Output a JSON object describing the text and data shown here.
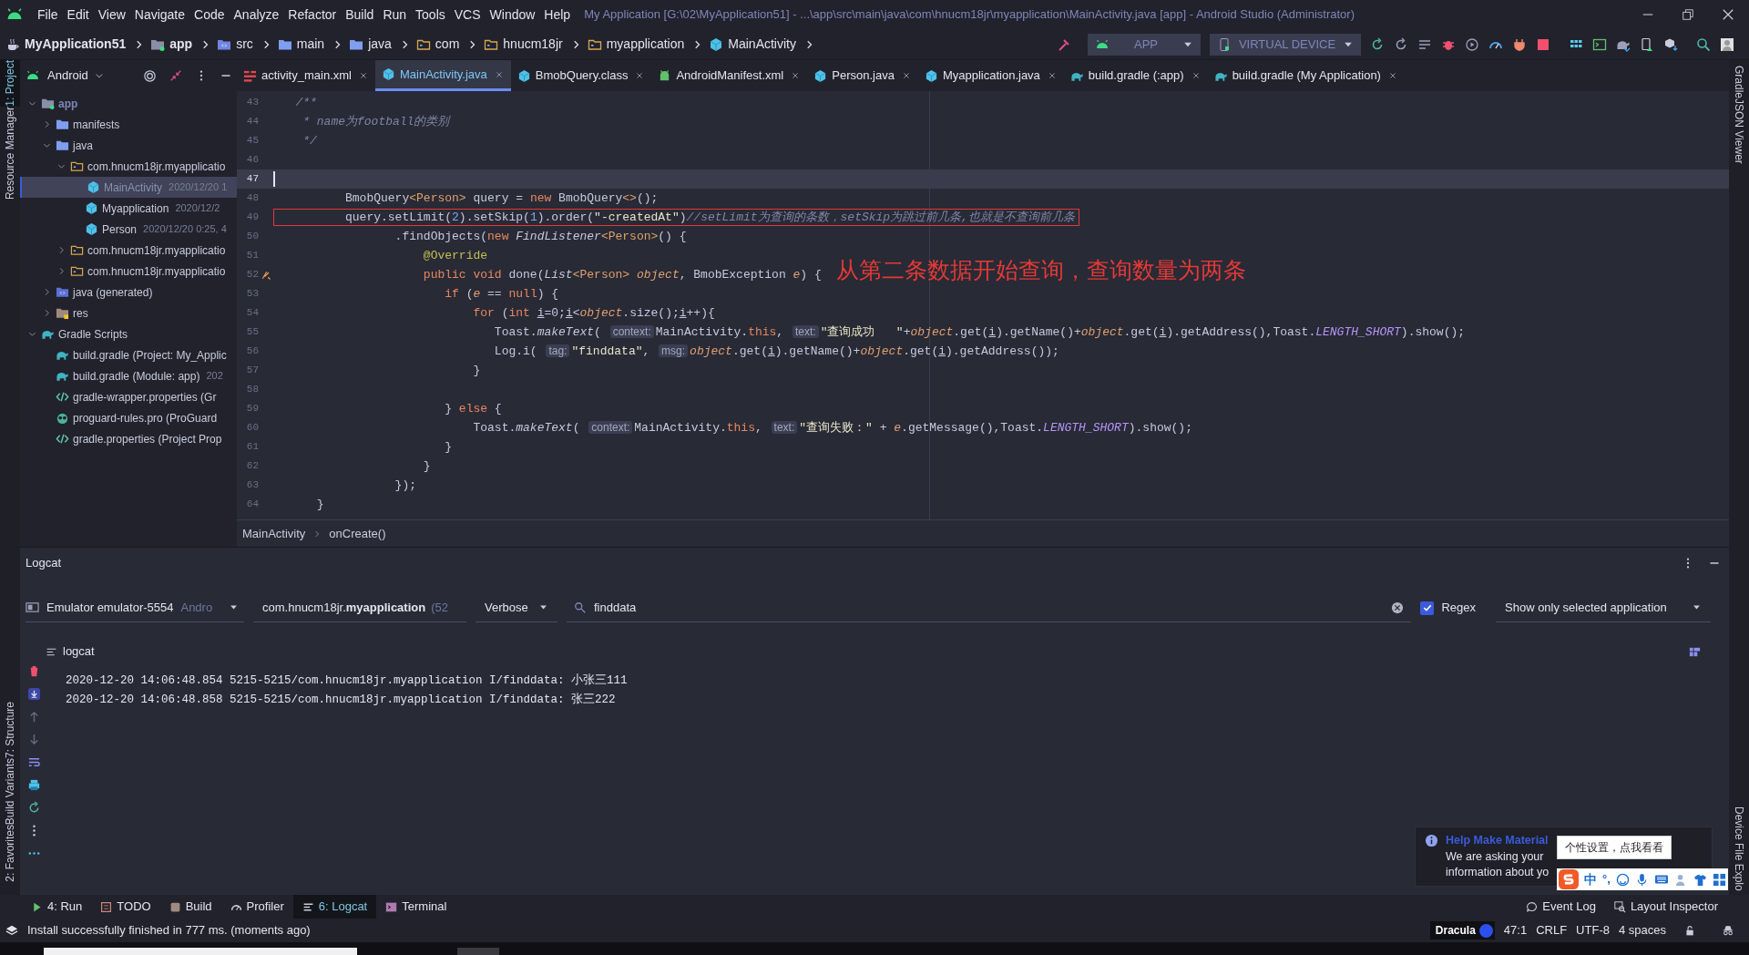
{
  "window": {
    "title": "My Application [G:\\02\\MyApplication51] - ...\\app\\src\\main\\java\\com\\hnucm18jr\\myapplication\\MainActivity.java [app] - Android Studio (Administrator)"
  },
  "menu": [
    "File",
    "Edit",
    "View",
    "Navigate",
    "Code",
    "Analyze",
    "Refactor",
    "Build",
    "Run",
    "Tools",
    "VCS",
    "Window",
    "Help"
  ],
  "breadcrumb": [
    {
      "label": "MyApplication51",
      "kind": "project"
    },
    {
      "label": "app",
      "kind": "module"
    },
    {
      "label": "src",
      "kind": "source"
    },
    {
      "label": "main",
      "kind": "folder"
    },
    {
      "label": "java",
      "kind": "folder"
    },
    {
      "label": "com",
      "kind": "package"
    },
    {
      "label": "hnucm18jr",
      "kind": "package"
    },
    {
      "label": "myapplication",
      "kind": "package"
    },
    {
      "label": "MainActivity",
      "kind": "class"
    }
  ],
  "run_config": {
    "module": "APP",
    "device": "VIRTUAL DEVICE"
  },
  "left_tool_windows": [
    {
      "label": "1: Project",
      "selected": true
    },
    {
      "label": "Resource Manager",
      "selected": false
    }
  ],
  "left_tool_windows_lower": [
    {
      "label": "7: Structure"
    },
    {
      "label": "Build Variants"
    },
    {
      "label": "2: Favorites"
    }
  ],
  "right_tool_windows": [
    "Gradle",
    "JSON Viewer"
  ],
  "right_tool_windows_lower": [
    "Device File Explo"
  ],
  "project_panel": {
    "view": "Android",
    "tree": [
      {
        "label": "app",
        "kind": "module",
        "expanded": true,
        "selected": false,
        "children": [
          {
            "label": "manifests",
            "kind": "folder",
            "expanded": false,
            "selected": false
          },
          {
            "label": "java",
            "kind": "folder",
            "expanded": true,
            "selected": false,
            "children": [
              {
                "label": "com.hnucm18jr.myapplicatio",
                "kind": "package",
                "expanded": true,
                "selected": false,
                "children": [
                  {
                    "label": "MainActivity",
                    "kind": "class",
                    "date": "2020/12/20 1",
                    "selected": true
                  },
                  {
                    "label": "Myapplication",
                    "kind": "class",
                    "date": "2020/12/2",
                    "selected": false
                  },
                  {
                    "label": "Person",
                    "kind": "class",
                    "date": "2020/12/20 0:25, 4",
                    "selected": false
                  }
                ]
              },
              {
                "label": "com.hnucm18jr.myapplicatio",
                "kind": "package",
                "expanded": false,
                "selected": false
              },
              {
                "label": "com.hnucm18jr.myapplicatio",
                "kind": "package",
                "expanded": false,
                "selected": false
              }
            ]
          },
          {
            "label": "java (generated)",
            "kind": "generated",
            "expanded": false,
            "selected": false
          },
          {
            "label": "res",
            "kind": "res",
            "expanded": false,
            "selected": false
          }
        ]
      },
      {
        "label": "Gradle Scripts",
        "kind": "gradle",
        "expanded": true,
        "selected": false,
        "children": [
          {
            "label": "build.gradle (Project: My_Applic",
            "kind": "gradle",
            "selected": false
          },
          {
            "label": "build.gradle (Module: app)",
            "kind": "gradle",
            "date": "202",
            "selected": false
          },
          {
            "label": "gradle-wrapper.properties (Gr",
            "kind": "props",
            "selected": false
          },
          {
            "label": "proguard-rules.pro (ProGuard",
            "kind": "owl",
            "selected": false
          },
          {
            "label": "gradle.properties (Project Prop",
            "kind": "props",
            "selected": false
          }
        ]
      }
    ]
  },
  "editor": {
    "tabs": [
      {
        "label": "activity_main.xml",
        "kind": "layout",
        "selected": false
      },
      {
        "label": "MainActivity.java",
        "kind": "class",
        "selected": true
      },
      {
        "label": "BmobQuery.class",
        "kind": "class",
        "selected": false
      },
      {
        "label": "AndroidManifest.xml",
        "kind": "manifest",
        "selected": false
      },
      {
        "label": "Person.java",
        "kind": "class",
        "selected": false
      },
      {
        "label": "Myapplication.java",
        "kind": "class",
        "selected": false
      },
      {
        "label": "build.gradle (:app)",
        "kind": "gradle",
        "selected": false
      },
      {
        "label": "build.gradle (My Application)",
        "kind": "gradle",
        "selected": false
      }
    ],
    "lines": [
      {
        "number": "43",
        "current": false,
        "boxed": false,
        "override_marker": false,
        "tokens": [
          {
            "text": "   /**",
            "kind": "comment"
          }
        ]
      },
      {
        "number": "44",
        "current": false,
        "boxed": false,
        "override_marker": false,
        "tokens": [
          {
            "text": "    * name为football的类别",
            "kind": "comment"
          }
        ]
      },
      {
        "number": "45",
        "current": false,
        "boxed": false,
        "override_marker": false,
        "tokens": [
          {
            "text": "    */",
            "kind": "comment"
          }
        ]
      },
      {
        "number": "46",
        "current": false,
        "override_marker": false
      },
      {
        "number": "47",
        "current": true,
        "override_marker": false
      },
      {
        "number": "48",
        "current": false,
        "boxed": false,
        "override_marker": false,
        "tokens": [
          {
            "text": "          BmobQuery",
            "kind": "plain"
          },
          {
            "text": "<Person>",
            "kind": "type"
          },
          {
            "text": " query = ",
            "kind": "plain"
          },
          {
            "text": "new",
            "kind": "kw"
          },
          {
            "text": " BmobQuery",
            "kind": "plain"
          },
          {
            "text": "<>",
            "kind": "type"
          },
          {
            "text": "();",
            "kind": "plain"
          }
        ]
      },
      {
        "number": "49",
        "current": false,
        "boxed": true,
        "override_marker": false,
        "tokens": [
          {
            "text": "          query.setLimit(",
            "kind": "plain"
          },
          {
            "text": "2",
            "kind": "num"
          },
          {
            "text": ").setSkip(",
            "kind": "plain"
          },
          {
            "text": "1",
            "kind": "num"
          },
          {
            "text": ").order(",
            "kind": "plain"
          },
          {
            "text": "\"-createdAt\"",
            "kind": "str"
          },
          {
            "text": ")",
            "kind": "plain"
          },
          {
            "text": "//setLimit为查询的条数，setSkip为跳过前几条,也就是不查询前几条",
            "kind": "comment"
          }
        ]
      },
      {
        "number": "50",
        "current": false,
        "boxed": false,
        "override_marker": false,
        "tokens": [
          {
            "text": "                 .findObjects(",
            "kind": "plain"
          },
          {
            "text": "new",
            "kind": "kw"
          },
          {
            "text": " FindListener",
            "kind": "italic"
          },
          {
            "text": "<Person>",
            "kind": "type"
          },
          {
            "text": "() {",
            "kind": "plain"
          }
        ]
      },
      {
        "number": "51",
        "current": false,
        "boxed": false,
        "override_marker": false,
        "tokens": [
          {
            "text": "                     @Override",
            "kind": "ann"
          }
        ]
      },
      {
        "number": "52",
        "current": false,
        "boxed": false,
        "override_marker": true,
        "tokens": [
          {
            "text": "                     public void",
            "kind": "kw"
          },
          {
            "text": " done(",
            "kind": "plain"
          },
          {
            "text": "List",
            "kind": "italic"
          },
          {
            "text": "<Person> ",
            "kind": "type"
          },
          {
            "text": "object",
            "kind": "param"
          },
          {
            "text": ", BmobException ",
            "kind": "plain"
          },
          {
            "text": "e",
            "kind": "param"
          },
          {
            "text": ") {",
            "kind": "plain"
          }
        ]
      },
      {
        "number": "53",
        "current": false,
        "boxed": false,
        "override_marker": false,
        "tokens": [
          {
            "text": "                        if",
            "kind": "kw"
          },
          {
            "text": " (",
            "kind": "plain"
          },
          {
            "text": "e",
            "kind": "param"
          },
          {
            "text": " == ",
            "kind": "plain"
          },
          {
            "text": "null",
            "kind": "kw"
          },
          {
            "text": ") {",
            "kind": "plain"
          }
        ]
      },
      {
        "number": "54",
        "current": false,
        "boxed": false,
        "override_marker": false,
        "tokens": [
          {
            "text": "                            for",
            "kind": "kw"
          },
          {
            "text": " (",
            "kind": "plain"
          },
          {
            "text": "int ",
            "kind": "kw"
          },
          {
            "text": "i",
            "kind": "var"
          },
          {
            "text": "=0;",
            "kind": "plain"
          },
          {
            "text": "i",
            "kind": "var"
          },
          {
            "text": "<",
            "kind": "plain"
          },
          {
            "text": "object",
            "kind": "param"
          },
          {
            "text": ".size();",
            "kind": "plain"
          },
          {
            "text": "i",
            "kind": "var"
          },
          {
            "text": "++){",
            "kind": "plain"
          }
        ]
      },
      {
        "number": "55",
        "current": false,
        "boxed": false,
        "override_marker": false,
        "tokens": [
          {
            "text": "                               Toast.",
            "kind": "plain"
          },
          {
            "text": "makeText",
            "kind": "italic"
          },
          {
            "text": "( ",
            "kind": "plain"
          },
          {
            "text": "context:",
            "kind": "hint"
          },
          {
            "text": "MainActivity.",
            "kind": "plain"
          },
          {
            "text": "this",
            "kind": "kw"
          },
          {
            "text": ", ",
            "kind": "plain"
          },
          {
            "text": "text:",
            "kind": "hint"
          },
          {
            "text": "\"查询成功   \"",
            "kind": "str"
          },
          {
            "text": "+",
            "kind": "plain"
          },
          {
            "text": "object",
            "kind": "param"
          },
          {
            "text": ".get(",
            "kind": "plain"
          },
          {
            "text": "i",
            "kind": "var"
          },
          {
            "text": ").getName()+",
            "kind": "plain"
          },
          {
            "text": "object",
            "kind": "param"
          },
          {
            "text": ".get(",
            "kind": "plain"
          },
          {
            "text": "i",
            "kind": "var"
          },
          {
            "text": ").getAddress(),Toast.",
            "kind": "plain"
          },
          {
            "text": "LENGTH_SHORT",
            "kind": "const"
          },
          {
            "text": ").show();",
            "kind": "plain"
          }
        ]
      },
      {
        "number": "56",
        "current": false,
        "boxed": false,
        "override_marker": false,
        "tokens": [
          {
            "text": "                               Log.i( ",
            "kind": "plain"
          },
          {
            "text": "tag:",
            "kind": "hint"
          },
          {
            "text": "\"finddata\"",
            "kind": "str"
          },
          {
            "text": ", ",
            "kind": "plain"
          },
          {
            "text": "msg:",
            "kind": "hint"
          },
          {
            "text": "object",
            "kind": "param"
          },
          {
            "text": ".get(",
            "kind": "plain"
          },
          {
            "text": "i",
            "kind": "var"
          },
          {
            "text": ").getName()+",
            "kind": "plain"
          },
          {
            "text": "object",
            "kind": "param"
          },
          {
            "text": ".get(",
            "kind": "plain"
          },
          {
            "text": "i",
            "kind": "var"
          },
          {
            "text": ").getAddress());",
            "kind": "plain"
          }
        ]
      },
      {
        "number": "57",
        "current": false,
        "boxed": false,
        "override_marker": false,
        "tokens": [
          {
            "text": "                            }",
            "kind": "plain"
          }
        ]
      },
      {
        "number": "58",
        "current": false,
        "override_marker": false
      },
      {
        "number": "59",
        "current": false,
        "boxed": false,
        "override_marker": false,
        "tokens": [
          {
            "text": "                        } ",
            "kind": "plain"
          },
          {
            "text": "else",
            "kind": "kw"
          },
          {
            "text": " {",
            "kind": "plain"
          }
        ]
      },
      {
        "number": "60",
        "current": false,
        "boxed": false,
        "override_marker": false,
        "tokens": [
          {
            "text": "                            Toast.",
            "kind": "plain"
          },
          {
            "text": "makeText",
            "kind": "italic"
          },
          {
            "text": "( ",
            "kind": "plain"
          },
          {
            "text": "context:",
            "kind": "hint"
          },
          {
            "text": "MainActivity.",
            "kind": "plain"
          },
          {
            "text": "this",
            "kind": "kw"
          },
          {
            "text": ", ",
            "kind": "plain"
          },
          {
            "text": "text:",
            "kind": "hint"
          },
          {
            "text": "\"查询失败：\"",
            "kind": "str"
          },
          {
            "text": " + ",
            "kind": "plain"
          },
          {
            "text": "e",
            "kind": "param"
          },
          {
            "text": ".getMessage(),Toast.",
            "kind": "plain"
          },
          {
            "text": "LENGTH_SHORT",
            "kind": "const"
          },
          {
            "text": ").show();",
            "kind": "plain"
          }
        ]
      },
      {
        "number": "61",
        "current": false,
        "boxed": false,
        "override_marker": false,
        "tokens": [
          {
            "text": "                        }",
            "kind": "plain"
          }
        ]
      },
      {
        "number": "62",
        "current": false,
        "boxed": false,
        "override_marker": false,
        "tokens": [
          {
            "text": "                     }",
            "kind": "plain"
          }
        ]
      },
      {
        "number": "63",
        "current": false,
        "boxed": false,
        "override_marker": false,
        "tokens": [
          {
            "text": "                 });",
            "kind": "plain"
          }
        ]
      },
      {
        "number": "64",
        "current": false,
        "boxed": false,
        "override_marker": false,
        "tokens": [
          {
            "text": "      }",
            "kind": "plain"
          }
        ]
      }
    ],
    "annotation": "从第二条数据开始查询，查询数量为两条",
    "breadcrumb": [
      "MainActivity",
      "onCreate()"
    ]
  },
  "logcat": {
    "title": "Logcat",
    "device": {
      "name": "Emulator emulator-5554",
      "suffix": "Andro"
    },
    "process": {
      "name": "com.hnucm18jr.**myapplication**",
      "suffix": "(52"
    },
    "level": "Verbose",
    "search": "finddata",
    "regex": {
      "label": "Regex",
      "checked": true
    },
    "scope": "Show only selected application",
    "label": "logcat",
    "lines": [
      "2020-12-20 14:06:48.854 5215-5215/com.hnucm18jr.myapplication I/finddata: 小张三111",
      "2020-12-20 14:06:48.858 5215-5215/com.hnucm18jr.myapplication I/finddata: 张三222"
    ]
  },
  "tool_tabs": [
    {
      "label": "4: Run",
      "kind": "run",
      "selected": false
    },
    {
      "label": "TODO",
      "kind": "todo",
      "selected": false
    },
    {
      "label": "Build",
      "kind": "build",
      "selected": false
    },
    {
      "label": "Profiler",
      "kind": "profiler",
      "selected": false
    },
    {
      "label": "6: Logcat",
      "kind": "logcat",
      "selected": true
    },
    {
      "label": "Terminal",
      "kind": "terminal",
      "selected": false
    }
  ],
  "tool_tabs_right": [
    {
      "label": "Event Log",
      "kind": "event"
    },
    {
      "label": "Layout Inspector",
      "kind": "inspector"
    }
  ],
  "notification": {
    "title": "Help Make Material",
    "lines": [
      "We are asking your",
      "information about yo"
    ]
  },
  "ime": {
    "tooltip": "个性设置，点我看看",
    "mode": "中",
    "punctuation": "°,"
  },
  "status_bar": {
    "message": "Install successfully finished in 777 ms. (moments ago)",
    "theme": "Dracula",
    "position": "47:1",
    "line_separator": "CRLF",
    "encoding": "UTF-8",
    "indent": "4 spaces"
  }
}
